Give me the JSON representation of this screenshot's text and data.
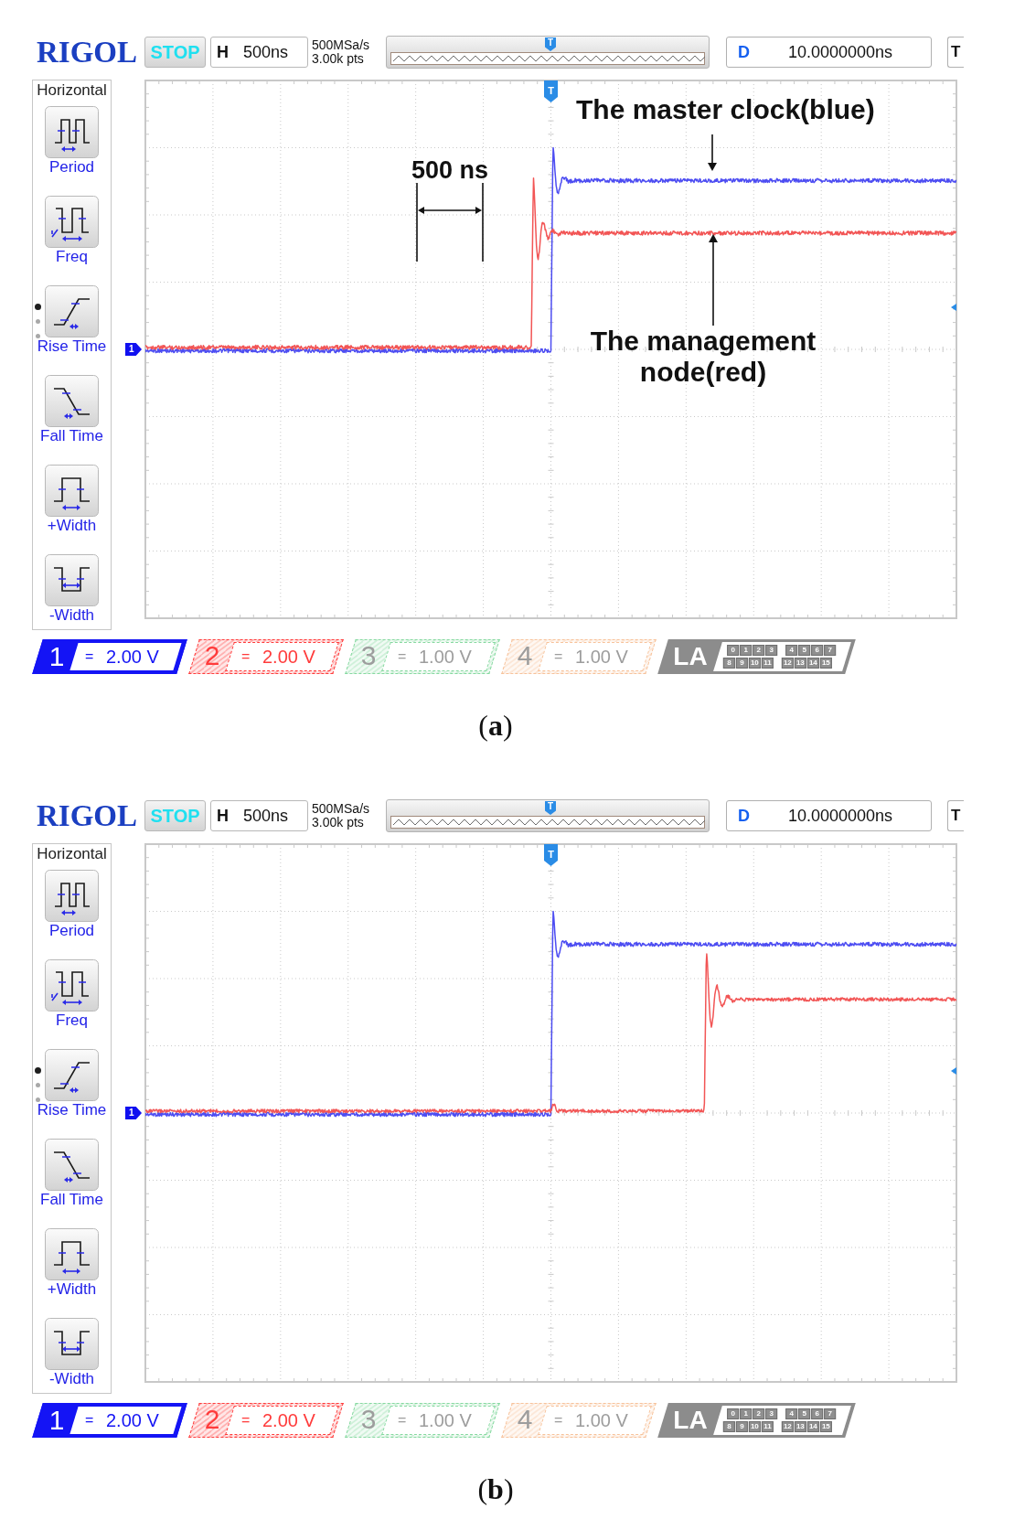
{
  "figures": [
    {
      "toolbar": {
        "logo": "RIGOL",
        "run_state": "STOP",
        "timebase": {
          "label": "H",
          "value": "500ns"
        },
        "sample_rate": "500MSa/s",
        "memory_depth": "3.00k pts",
        "overview_marker": "T",
        "delay": {
          "label": "D",
          "value": "10.0000000ns"
        },
        "trigger_button": "T"
      },
      "menu": {
        "title": "Horizontal",
        "items": [
          {
            "kind": "period",
            "label": "Period"
          },
          {
            "kind": "frequency",
            "label": "Freq"
          },
          {
            "kind": "rise_time",
            "label": "Rise Time"
          },
          {
            "kind": "fall_time",
            "label": "Fall Time"
          },
          {
            "kind": "positive_width",
            "label": "+Width"
          },
          {
            "kind": "negative_width",
            "label": "-Width"
          }
        ],
        "pages": [
          {
            "selected": true
          },
          {
            "selected": false
          },
          {
            "selected": false
          }
        ]
      },
      "display": {
        "trigger_marker": "T",
        "ground_marker": "1",
        "traces": [
          {
            "kind": "clock_rise",
            "color": "#4d4df2"
          },
          {
            "kind": "node_early_rise",
            "color": "#f25555"
          }
        ],
        "annotations": [
          {
            "kind": "clock_callout",
            "text": "The master clock(blue)"
          },
          {
            "kind": "span",
            "text": "500 ns"
          },
          {
            "kind": "node_callout",
            "text": "The management node(red)"
          }
        ]
      },
      "channels": [
        {
          "number": "1",
          "coupling": "=",
          "scale": "2.00 V",
          "color": "#1414f5",
          "on": true,
          "selected": true
        },
        {
          "number": "2",
          "coupling": "=",
          "scale": "2.00 V",
          "color": "#ff3b3b",
          "on": true,
          "selected": false
        },
        {
          "number": "3",
          "coupling": "=",
          "scale": "1.00 V",
          "color": "#86d9a0",
          "on": false,
          "selected": false
        },
        {
          "number": "4",
          "coupling": "=",
          "scale": "1.00 V",
          "color": "#f7c29a",
          "on": false,
          "selected": false
        }
      ],
      "logic_analyzer": {
        "label": "LA",
        "bits": [
          "0",
          "1",
          "2",
          "3",
          "4",
          "5",
          "6",
          "7",
          "8",
          "9",
          "10",
          "11",
          "12",
          "13",
          "14",
          "15"
        ]
      },
      "caption": "(**a**)"
    },
    {
      "toolbar": {
        "logo": "RIGOL",
        "run_state": "STOP",
        "timebase": {
          "label": "H",
          "value": "500ns"
        },
        "sample_rate": "500MSa/s",
        "memory_depth": "3.00k pts",
        "overview_marker": "T",
        "delay": {
          "label": "D",
          "value": "10.0000000ns"
        },
        "trigger_button": "T"
      },
      "menu": {
        "title": "Horizontal",
        "items": [
          {
            "kind": "period",
            "label": "Period"
          },
          {
            "kind": "frequency",
            "label": "Freq"
          },
          {
            "kind": "rise_time",
            "label": "Rise Time"
          },
          {
            "kind": "fall_time",
            "label": "Fall Time"
          },
          {
            "kind": "positive_width",
            "label": "+Width"
          },
          {
            "kind": "negative_width",
            "label": "-Width"
          }
        ],
        "pages": [
          {
            "selected": true
          },
          {
            "selected": false
          },
          {
            "selected": false
          }
        ]
      },
      "display": {
        "trigger_marker": "T",
        "ground_marker": "1",
        "traces": [
          {
            "kind": "clock_rise",
            "color": "#4d4df2"
          },
          {
            "kind": "node_late_rise",
            "color": "#f25555"
          }
        ]
      },
      "channels": [
        {
          "number": "1",
          "coupling": "=",
          "scale": "2.00 V",
          "color": "#1414f5",
          "on": true,
          "selected": true
        },
        {
          "number": "2",
          "coupling": "=",
          "scale": "2.00 V",
          "color": "#ff3b3b",
          "on": true,
          "selected": false
        },
        {
          "number": "3",
          "coupling": "=",
          "scale": "1.00 V",
          "color": "#86d9a0",
          "on": false,
          "selected": false
        },
        {
          "number": "4",
          "coupling": "=",
          "scale": "1.00 V",
          "color": "#f7c29a",
          "on": false,
          "selected": false
        }
      ],
      "logic_analyzer": {
        "label": "LA",
        "bits": [
          "0",
          "1",
          "2",
          "3",
          "4",
          "5",
          "6",
          "7",
          "8",
          "9",
          "10",
          "11",
          "12",
          "13",
          "14",
          "15"
        ]
      },
      "caption": "(**b**)"
    }
  ]
}
